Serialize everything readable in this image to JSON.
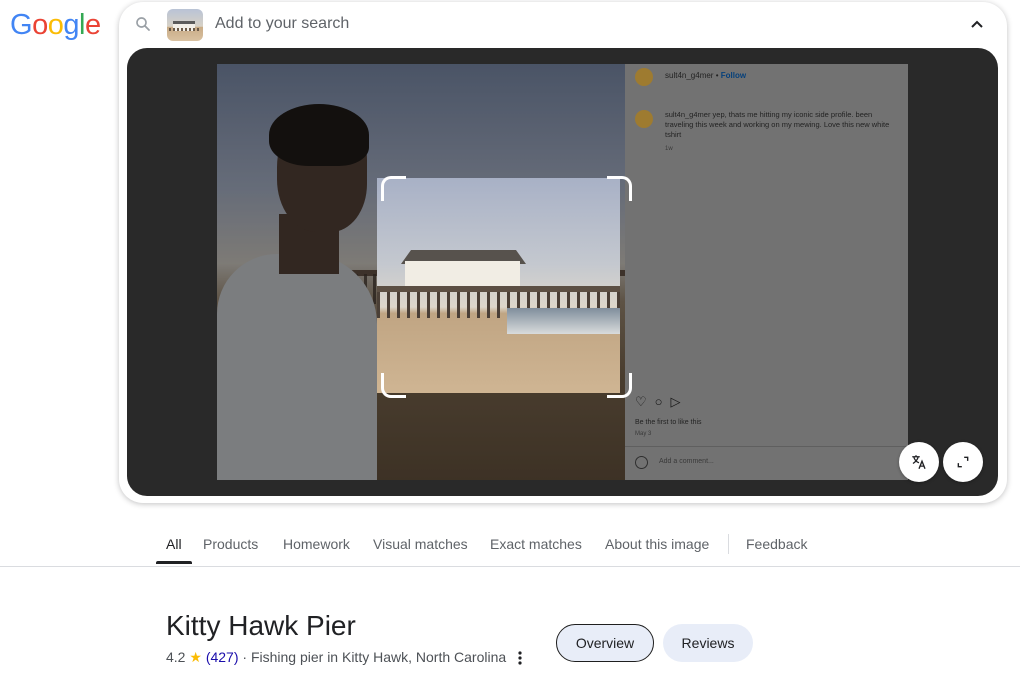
{
  "logo": {
    "letters": [
      "G",
      "o",
      "o",
      "g",
      "l",
      "e"
    ],
    "colors": [
      "#4285F4",
      "#EA4335",
      "#FBBC05",
      "#4285F4",
      "#34A853",
      "#EA4335"
    ]
  },
  "search": {
    "placeholder": "Add to your search"
  },
  "viewer": {
    "instagram": {
      "username": "sult4n_g4mer",
      "follow": "Follow",
      "comment_user": "sult4n_g4mer",
      "comment_text": "yep, thats me hitting my iconic side profile. been traveling this week and working on my mewing. Love this new white tshirt",
      "comment_time": "1w",
      "likes": "Be the first to like this",
      "date": "May 3",
      "add_comment_placeholder": "Add a comment..."
    }
  },
  "tabs": [
    {
      "label": "All",
      "active": true
    },
    {
      "label": "Products"
    },
    {
      "label": "Homework"
    },
    {
      "label": "Visual matches"
    },
    {
      "label": "Exact matches"
    },
    {
      "label": "About this image"
    },
    {
      "label": "Feedback"
    }
  ],
  "place": {
    "title": "Kitty Hawk Pier",
    "rating": "4.2",
    "star": "★",
    "review_count": "(427)",
    "category": "· Fishing pier in Kitty Hawk, North Carolina"
  },
  "actions": {
    "overview": "Overview",
    "reviews": "Reviews"
  }
}
